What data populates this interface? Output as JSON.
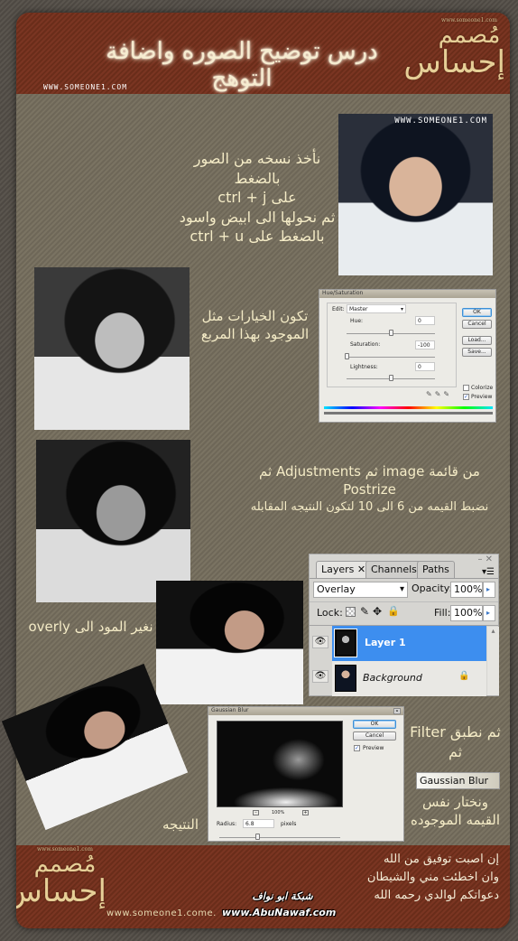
{
  "header": {
    "title": "درس توضيح الصوره واضافة التوهج",
    "site": "WWW.SOMEONE1.COM",
    "logo_line1": "مُصمم",
    "logo_line2": "إحساس",
    "logo_small": "www.someone1.com"
  },
  "steps": {
    "step1": {
      "lines": [
        "نأخذ نسخه من الصور بالضغط",
        "على ctrl + j",
        "ثم نحولها الى ابيض واسود",
        "بالضغط على ctrl + u"
      ],
      "photo_watermark": "WWW.SOMEONE1.COM"
    },
    "step2": {
      "lines": [
        "تكون الخيارات مثل",
        "الموجود بهذا المربع"
      ]
    },
    "hue_saturation": {
      "title": "Hue/Saturation",
      "edit_label": "Edit:",
      "edit_value": "Master",
      "hue_label": "Hue:",
      "hue_value": "0",
      "saturation_label": "Saturation:",
      "saturation_value": "-100",
      "lightness_label": "Lightness:",
      "lightness_value": "0",
      "ok": "OK",
      "cancel": "Cancel",
      "load": "Load...",
      "save": "Save...",
      "colorize": "Colorize",
      "preview": "Preview",
      "preview_checked": true,
      "colorize_checked": false
    },
    "step3": {
      "lines": [
        "من قائمة image ثم Adjustments ثم",
        "Postrize",
        "نضبط القيمه من 6 الى 10 لتكون النتيجه المقابله"
      ]
    },
    "layers_panel": {
      "tabs": [
        "Layers",
        "Channels",
        "Paths"
      ],
      "active_tab": "Layers",
      "blend_mode": "Overlay",
      "opacity_label": "Opacity:",
      "opacity_value": "100%",
      "lock_label": "Lock:",
      "fill_label": "Fill:",
      "fill_value": "100%",
      "layers": [
        {
          "name": "Layer 1",
          "selected": true
        },
        {
          "name": "Background",
          "selected": false,
          "locked": true
        }
      ]
    },
    "step4": {
      "text": "نغير المود الى overly"
    },
    "gaussian_blur": {
      "title": "Gaussian Blur",
      "ok": "OK",
      "cancel": "Cancel",
      "preview": "Preview",
      "preview_checked": true,
      "zoom": "100%",
      "radius_label": "Radius:",
      "radius_value": "6.8",
      "radius_unit": "pixels"
    },
    "step5": {
      "line1": "ثم نطبق Filter",
      "line2": "ثم",
      "filter_name": "Gaussian Blur",
      "line3": "ونختار نفس",
      "line4": "القيمه الموجوده"
    },
    "result_label": "النتيجه"
  },
  "footer": {
    "lines": [
      "إن اصبت توفيق من الله",
      "وان اخطئت مني والشيطان",
      "دعواتكم لوالدي رحمه الله"
    ],
    "site": "www.someone1.come.",
    "network_name": "شبكة ابو نواف",
    "network_url": "www.AbuNawaf.com",
    "logo_line1": "مُصمم",
    "logo_line2": "إحساس",
    "logo_small": "www.someone1.com"
  }
}
